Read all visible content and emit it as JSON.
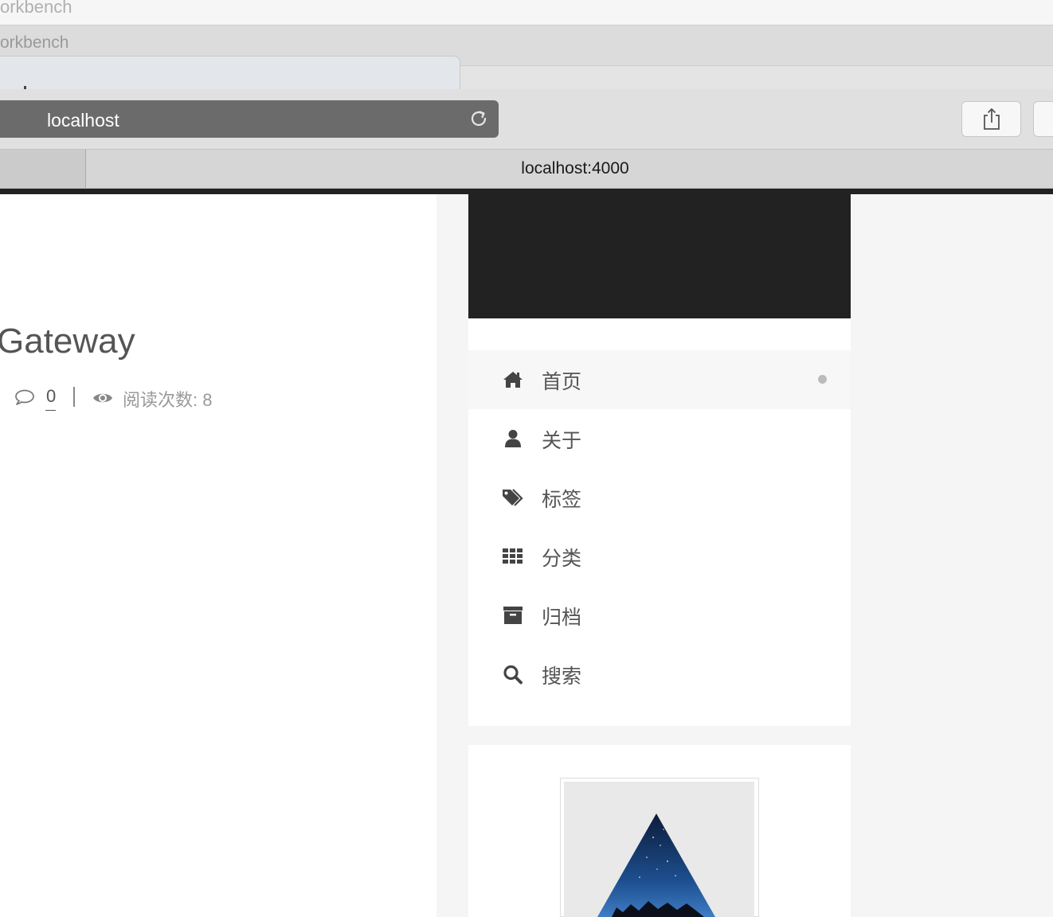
{
  "window": {
    "title": "orkbench",
    "tabstrip_label": "orkbench"
  },
  "browser": {
    "address": "localhost",
    "page_tab_title": "localhost:4000"
  },
  "post": {
    "title": "Gateway",
    "comment_count": "0",
    "read_count": "阅读次数: 8"
  },
  "sidebar": {
    "menu": [
      {
        "label": "首页",
        "icon": "home-icon",
        "active": true
      },
      {
        "label": "关于",
        "icon": "user-icon",
        "active": false
      },
      {
        "label": "标签",
        "icon": "tags-icon",
        "active": false
      },
      {
        "label": "分类",
        "icon": "th-icon",
        "active": false
      },
      {
        "label": "归档",
        "icon": "archive-icon",
        "active": false
      },
      {
        "label": "搜索",
        "icon": "search-icon",
        "active": false
      }
    ]
  },
  "colors": {
    "header_dark": "#222222",
    "text": "#555555",
    "muted": "#999999",
    "page_bg": "#f5f5f5"
  }
}
